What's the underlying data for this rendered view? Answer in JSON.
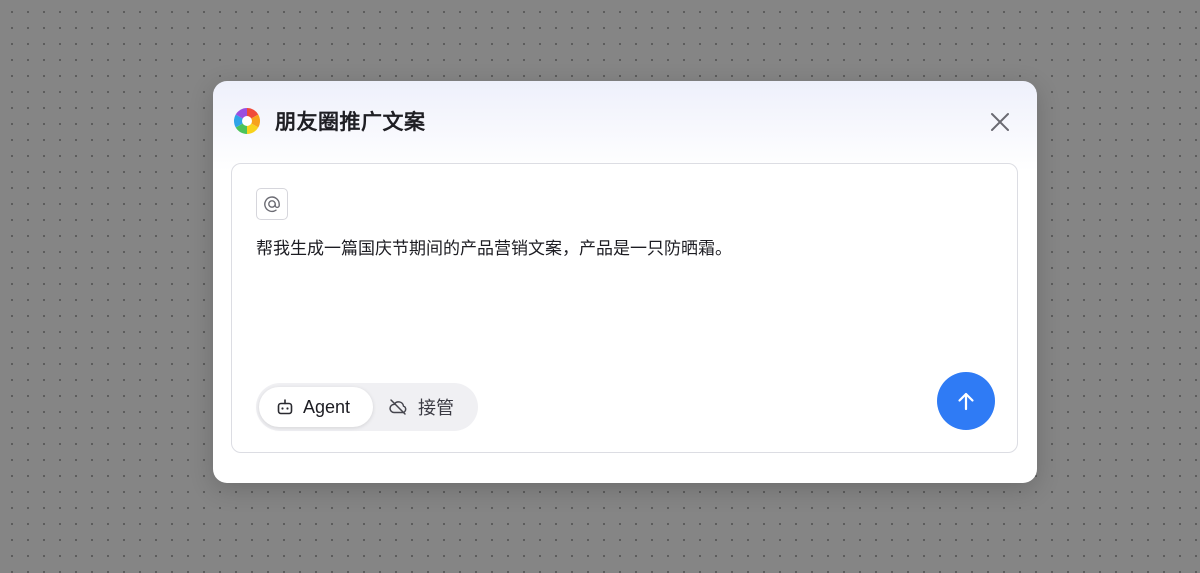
{
  "dialog": {
    "title": "朋友圈推广文案",
    "logo_icon": "color-wheel-logo-icon",
    "close_icon": "close-icon"
  },
  "input": {
    "mention_icon": "at-sign-icon",
    "prompt_text": "帮我生成一篇国庆节期间的产品营销文案，产品是一只防晒霜。"
  },
  "modes": {
    "selected": "Agent",
    "items": [
      {
        "label": "Agent",
        "icon": "robot-icon",
        "active": true
      },
      {
        "label": "接管",
        "icon": "cloud-off-icon",
        "active": false
      }
    ]
  },
  "send_button": {
    "icon": "arrow-up-icon",
    "color": "#2f7bf5"
  },
  "colors": {
    "backdrop": "#858585",
    "accent": "#2f7bf5"
  }
}
